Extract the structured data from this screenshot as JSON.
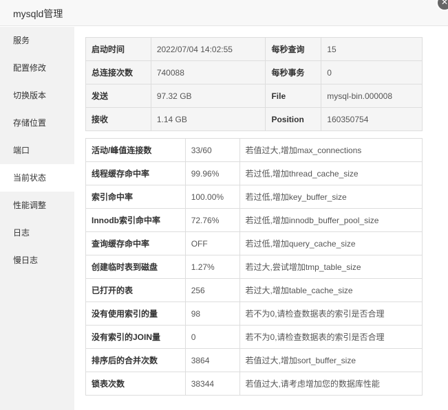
{
  "window": {
    "title": "mysqld管理",
    "close_glyph": "✕"
  },
  "sidebar": {
    "items": [
      {
        "label": "服务"
      },
      {
        "label": "配置修改"
      },
      {
        "label": "切换版本"
      },
      {
        "label": "存储位置"
      },
      {
        "label": "端口"
      },
      {
        "label": "当前状态"
      },
      {
        "label": "性能调整"
      },
      {
        "label": "日志"
      },
      {
        "label": "慢日志"
      }
    ],
    "active": "当前状态"
  },
  "summary": [
    {
      "k1": "启动时间",
      "v1": "2022/07/04 14:02:55",
      "k2": "每秒查询",
      "v2": "15"
    },
    {
      "k1": "总连接次数",
      "v1": "740088",
      "k2": "每秒事务",
      "v2": "0"
    },
    {
      "k1": "发送",
      "v1": "97.32 GB",
      "k2": "File",
      "v2": "mysql-bin.000008"
    },
    {
      "k1": "接收",
      "v1": "1.14 GB",
      "k2": "Position",
      "v2": "160350754"
    }
  ],
  "metrics": [
    {
      "name": "活动/峰值连接数",
      "value": "33/60",
      "hint": "若值过大,增加max_connections"
    },
    {
      "name": "线程缓存命中率",
      "value": "99.96%",
      "hint": "若过低,增加thread_cache_size"
    },
    {
      "name": "索引命中率",
      "value": "100.00%",
      "hint": "若过低,增加key_buffer_size"
    },
    {
      "name": "Innodb索引命中率",
      "value": "72.76%",
      "hint": "若过低,增加innodb_buffer_pool_size"
    },
    {
      "name": "查询缓存命中率",
      "value": "OFF",
      "hint": "若过低,增加query_cache_size"
    },
    {
      "name": "创建临时表到磁盘",
      "value": "1.27%",
      "hint": "若过大,尝试增加tmp_table_size"
    },
    {
      "name": "已打开的表",
      "value": "256",
      "hint": "若过大,增加table_cache_size"
    },
    {
      "name": "没有使用索引的量",
      "value": "98",
      "hint": "若不为0,请检查数据表的索引是否合理"
    },
    {
      "name": "没有索引的JOIN量",
      "value": "0",
      "hint": "若不为0,请检查数据表的索引是否合理"
    },
    {
      "name": "排序后的合并次数",
      "value": "3864",
      "hint": "若值过大,增加sort_buffer_size"
    },
    {
      "name": "锁表次数",
      "value": "38344",
      "hint": "若值过大,请考虑增加您的数据库性能"
    }
  ]
}
